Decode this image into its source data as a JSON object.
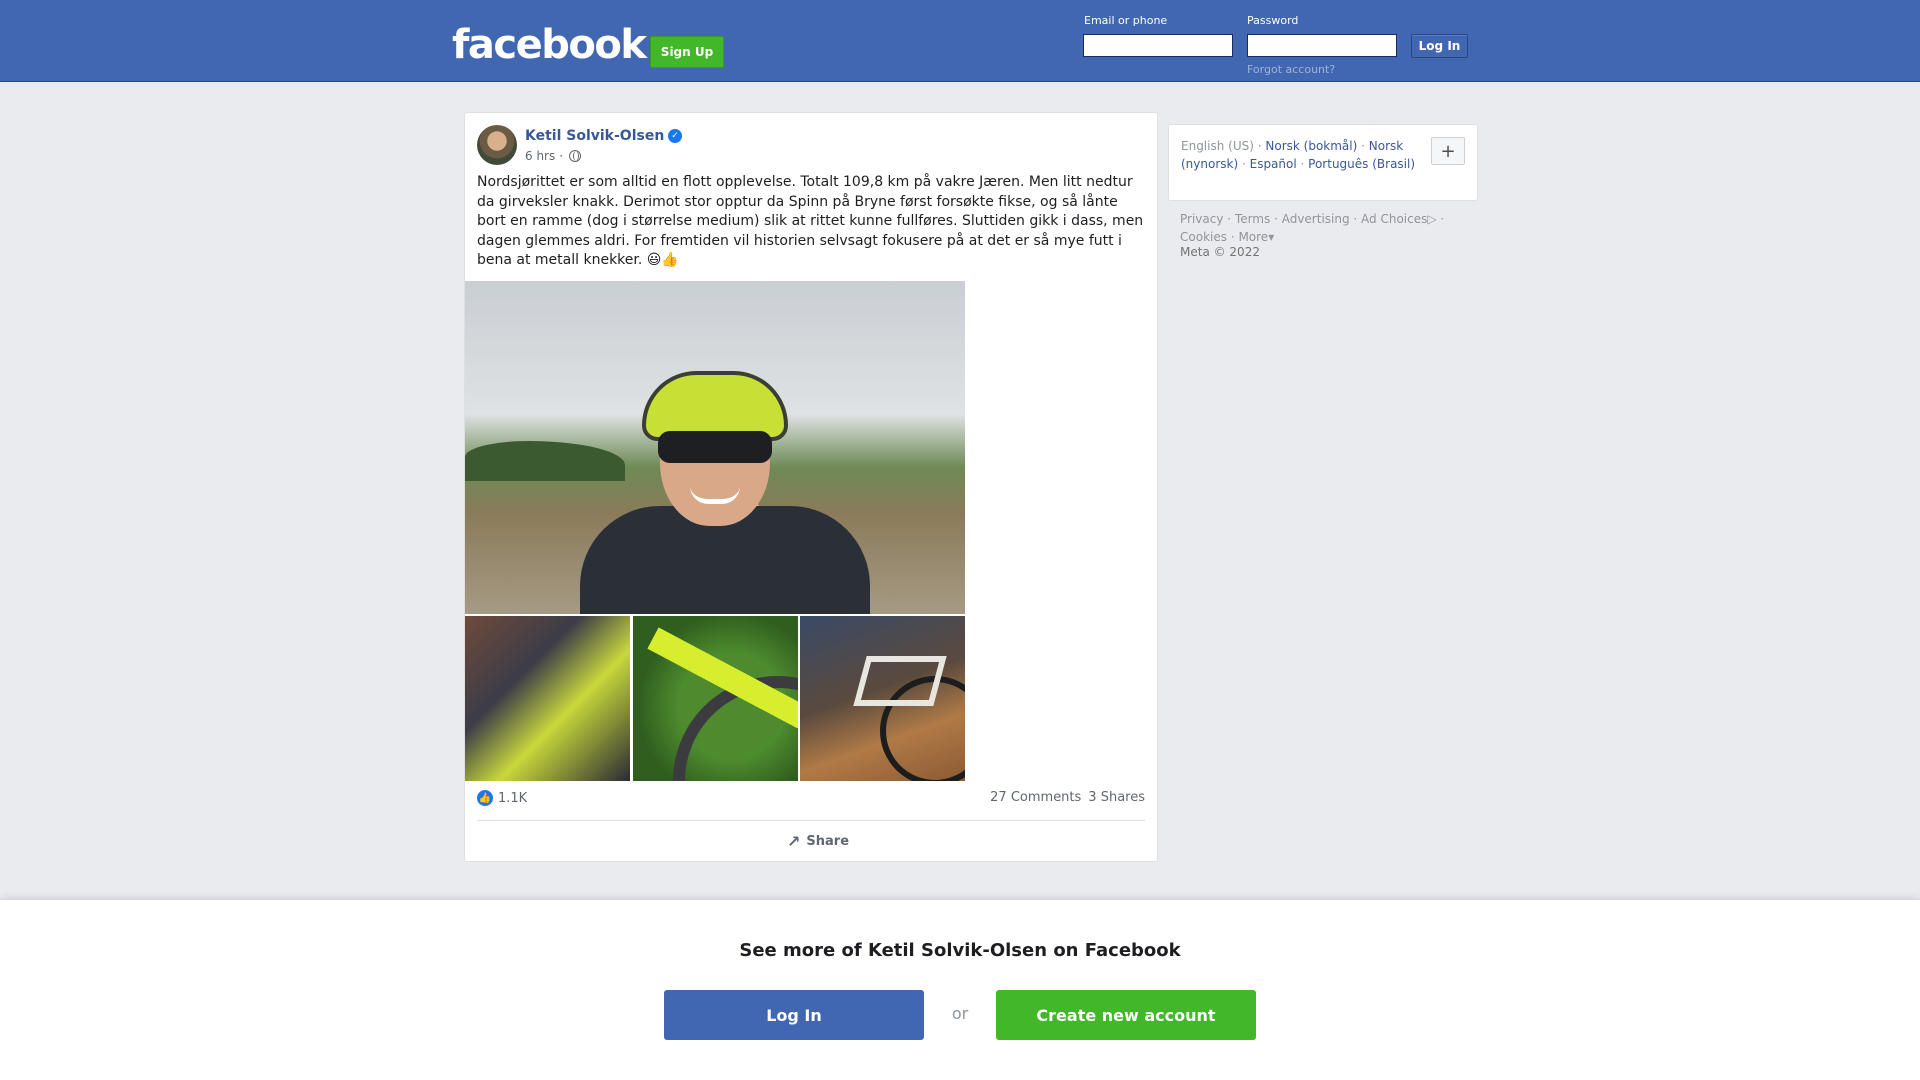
{
  "header": {
    "logo": "facebook",
    "signup_label": "Sign Up",
    "email_label": "Email or phone",
    "password_label": "Password",
    "login_label": "Log In",
    "forgot_label": "Forgot account?"
  },
  "post": {
    "author": "Ketil Solvik-Olsen",
    "time": "6 hrs",
    "privacy_icon": "globe-icon",
    "text": "Nordsjørittet er som alltid en flott opplevelse. Totalt 109,8 km på vakre Jæren. Men litt nedtur da girveksler knakk. Derimot stor opptur da Spinn på Bryne først forsøkte fikse, og så lånte bort en ramme (dog i størrelse medium) slik at rittet kunne fullføres. Sluttiden gikk i dass, men dagen glemmes aldri. For fremtiden vil historien selvsagt fokusere på at det er så mye futt i bena at metall knekker. 😃👍",
    "reactions": "1.1K",
    "comments": "27 Comments",
    "shares": "3 Shares",
    "share_label": "Share"
  },
  "sidebar": {
    "current_language": "English (US)",
    "languages": [
      "Norsk (bokmål)",
      "Norsk (nynorsk)",
      "Español",
      "Português (Brasil)"
    ],
    "footer_links": [
      "Privacy",
      "Terms",
      "Advertising",
      "Ad Choices",
      "Cookies",
      "More"
    ],
    "copyright": "Meta © 2022"
  },
  "bottom_banner": {
    "title": "See more of Ketil Solvik-Olsen on Facebook",
    "login_label": "Log In",
    "or_label": "or",
    "create_label": "Create new account"
  },
  "colors": {
    "brand_blue": "#4267b2",
    "link_blue": "#385898",
    "green": "#42b72a"
  }
}
